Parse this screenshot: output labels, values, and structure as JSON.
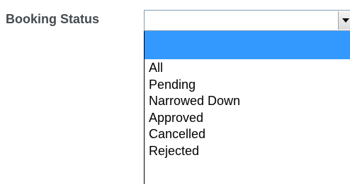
{
  "field": {
    "label": "Booking Status",
    "selected_value": ""
  },
  "dropdown": {
    "arrow_icon": "chevron-down-icon",
    "highlight_color": "#3399ff",
    "options": [
      {
        "label": "",
        "highlighted": true
      },
      {
        "label": "All",
        "highlighted": false
      },
      {
        "label": "Pending",
        "highlighted": false
      },
      {
        "label": "Narrowed Down",
        "highlighted": false
      },
      {
        "label": "Approved",
        "highlighted": false
      },
      {
        "label": "Cancelled",
        "highlighted": false
      },
      {
        "label": "Rejected",
        "highlighted": false
      }
    ]
  }
}
